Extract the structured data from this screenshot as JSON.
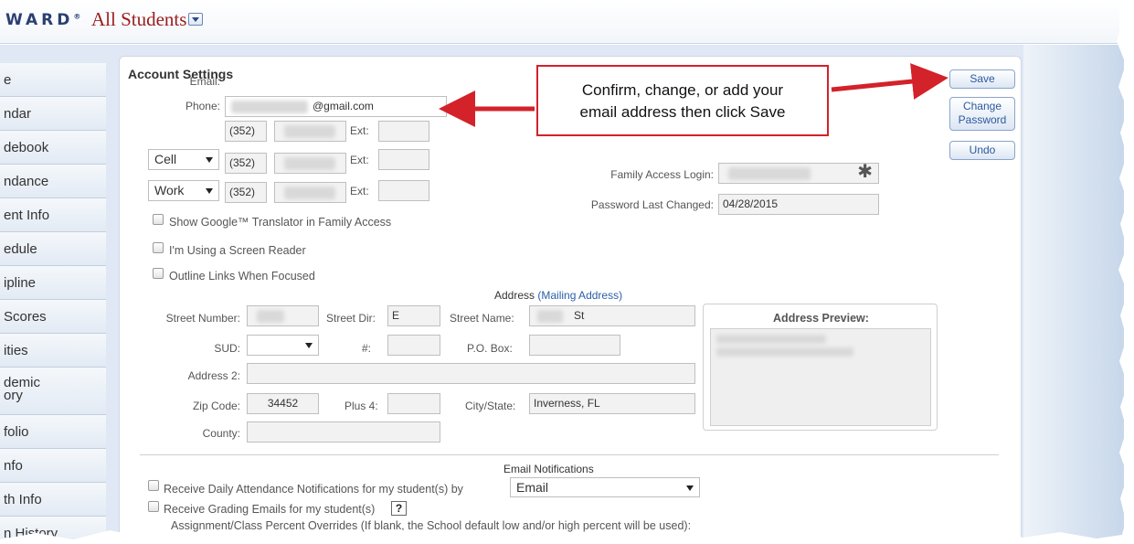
{
  "header": {
    "logo": "WARD",
    "logo_mark": "®",
    "title": "All Students"
  },
  "sidebar": {
    "items": [
      "e",
      "ndar",
      "debook",
      "ndance",
      "ent Info",
      "edule",
      "ipline",
      " Scores",
      "ities",
      "demic\nory",
      "folio",
      "nfo",
      "th Info",
      "n History"
    ]
  },
  "account": {
    "title": "Account Settings",
    "email_label": "Email:",
    "email_value": "@gmail.com",
    "phone_label": "Phone:",
    "area_code": "(352)",
    "ext_label": "Ext:",
    "phone_types": [
      "Cell",
      "Work"
    ],
    "family_login_label": "Family Access Login:",
    "family_login_icon": "asterisk-icon",
    "pwd_changed_label": "Password Last Changed:",
    "pwd_changed_value": "04/28/2015",
    "checkboxes": [
      "Show Google™ Translator in Family Access",
      "I'm Using a Screen Reader",
      "Outline Links When Focused"
    ]
  },
  "buttons": {
    "save": "Save",
    "change_password": "Change Password",
    "undo": "Undo"
  },
  "callout": {
    "line1": "Confirm, change, or add your",
    "line2": "email address then click Save",
    "color": "#d3222a"
  },
  "address": {
    "heading": "Address",
    "heading_link": "(Mailing Address)",
    "street_number_label": "Street Number:",
    "street_dir_label": "Street Dir:",
    "street_dir_value": "E",
    "street_name_label": "Street Name:",
    "street_name_value": "St",
    "sud_label": "SUD:",
    "num_label": "#:",
    "po_box_label": "P.O. Box:",
    "address2_label": "Address 2:",
    "zip_label": "Zip Code:",
    "zip_value": "34452",
    "plus4_label": "Plus 4:",
    "city_label": "City/State:",
    "city_value": "Inverness, FL",
    "county_label": "County:",
    "preview_title": "Address Preview:"
  },
  "notifications": {
    "heading": "Email Notifications",
    "attendance_label": "Receive Daily Attendance Notifications for my student(s) by",
    "attendance_method": "Email",
    "grading_label": "Receive Grading Emails for my student(s)",
    "help_icon": "?",
    "overrides_text": "Assignment/Class Percent Overrides (If blank, the School default low and/or high percent will be used):"
  }
}
